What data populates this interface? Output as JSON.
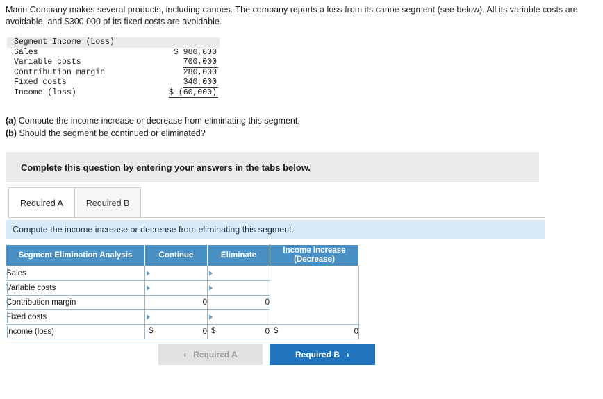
{
  "prompt": {
    "text": "Marin Company makes several products, including canoes. The company reports a loss from its canoe segment (see below). All its variable costs are avoidable, and $300,000 of its fixed costs are avoidable."
  },
  "income_table": {
    "title": "Segment Income (Loss)",
    "rows": [
      {
        "label": "Sales",
        "value": "$ 980,000",
        "rule": "none"
      },
      {
        "label": "Variable costs",
        "value": "700,000",
        "rule": "single"
      },
      {
        "label": "Contribution margin",
        "value": "280,000",
        "rule": "none"
      },
      {
        "label": "Fixed costs",
        "value": "340,000",
        "rule": "single"
      },
      {
        "label": "Income (loss)",
        "value": "$ (60,000)",
        "rule": "double"
      }
    ]
  },
  "questions": {
    "a_label": "(a)",
    "a_text": " Compute the income increase or decrease from eliminating this segment.",
    "b_label": "(b)",
    "b_text": " Should the segment be continued or eliminated?"
  },
  "instruction_bar": {
    "text": "Complete this question by entering your answers in the tabs below."
  },
  "tabs": [
    {
      "label": "Required A",
      "active": true
    },
    {
      "label": "Required B",
      "active": false
    }
  ],
  "blue_bar": {
    "text": "Compute the income increase or decrease from eliminating this segment."
  },
  "analysis_table": {
    "headers": {
      "col1": "Segment Elimination Analysis",
      "col2": "Continue",
      "col3": "Eliminate",
      "col4_line1": "Income Increase",
      "col4_line2": "(Decrease)"
    },
    "rows": [
      {
        "label": "Sales",
        "continue": {
          "dollar": "",
          "value": ""
        },
        "eliminate": {
          "dollar": "",
          "value": ""
        },
        "income": {
          "dollar": "",
          "value": ""
        }
      },
      {
        "label": "Variable costs",
        "continue": {
          "dollar": "",
          "value": ""
        },
        "eliminate": {
          "dollar": "",
          "value": ""
        },
        "income": {
          "dollar": "",
          "value": ""
        }
      },
      {
        "label": "Contribution margin",
        "continue": {
          "dollar": "",
          "value": "0"
        },
        "eliminate": {
          "dollar": "",
          "value": "0"
        },
        "income": {
          "dollar": "",
          "value": ""
        }
      },
      {
        "label": "Fixed costs",
        "continue": {
          "dollar": "",
          "value": ""
        },
        "eliminate": {
          "dollar": "",
          "value": ""
        },
        "income": {
          "dollar": "",
          "value": ""
        }
      },
      {
        "label": "Income (loss)",
        "continue": {
          "dollar": "$",
          "value": "0"
        },
        "eliminate": {
          "dollar": "$",
          "value": "0"
        },
        "income": {
          "dollar": "$",
          "value": "0"
        }
      }
    ]
  },
  "nav": {
    "prev_label": "Required A",
    "prev_chevron": "‹",
    "next_label": "Required B",
    "next_chevron": "›"
  },
  "colors": {
    "header_blue": "#4a90c4",
    "strip_blue": "#dbeaf7",
    "button_blue": "#1f74bd",
    "grey": "#ebebeb"
  }
}
